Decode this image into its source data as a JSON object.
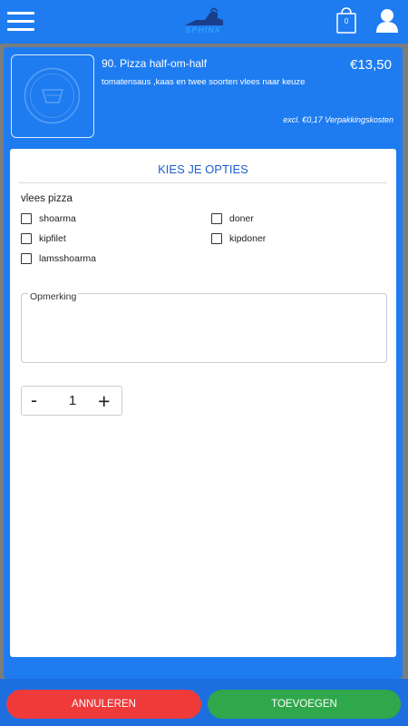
{
  "header": {
    "logo_text": "SPHINX",
    "cart_count": "0",
    "icons": [
      "menu-icon",
      "cart-icon",
      "user-icon"
    ]
  },
  "product": {
    "title": "90. Pizza half-om-half",
    "price": "€13,50",
    "description": "tomatensaus ,kaas en twee soorten vlees naar keuze",
    "packaging_note": "excl. €0,17 Verpakkingskosten"
  },
  "options": {
    "heading": "KIES JE OPTIES",
    "group_label": "vlees pizza",
    "items": [
      {
        "label": "shoarma",
        "checked": false
      },
      {
        "label": "doner",
        "checked": false
      },
      {
        "label": "kipfilet",
        "checked": false
      },
      {
        "label": "kipdoner",
        "checked": false
      },
      {
        "label": "lamsshoarma",
        "checked": false
      }
    ]
  },
  "remark": {
    "label": "Opmerking",
    "value": ""
  },
  "quantity": {
    "minus": "-",
    "value": "1",
    "plus": "+"
  },
  "footer": {
    "cancel_label": "ANNULEREN",
    "add_label": "TOEVOEGEN"
  },
  "colors": {
    "primary": "#1e7cf0",
    "heading": "#1e5fd0",
    "cancel": "#ef3a3a",
    "add": "#2fa84b"
  }
}
